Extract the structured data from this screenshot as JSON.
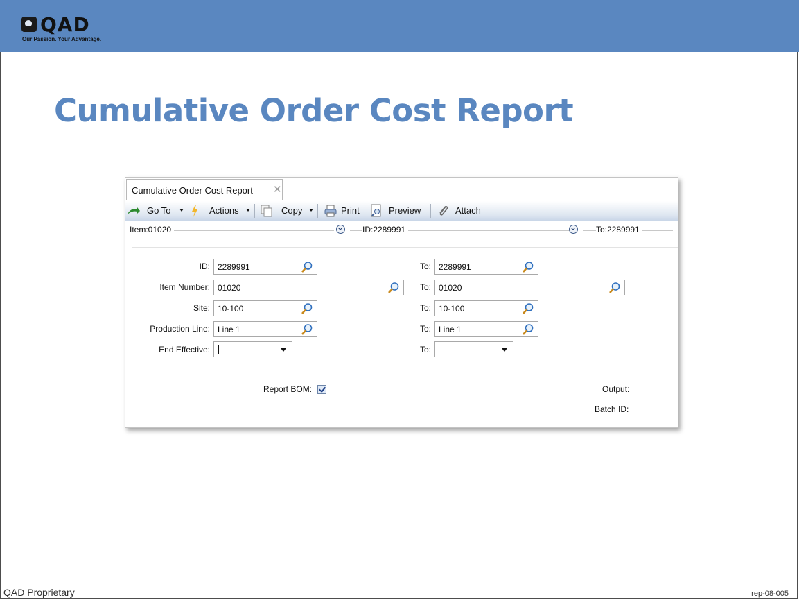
{
  "branding": {
    "logo_text": "QAD",
    "tagline": "Our Passion. Your Advantage."
  },
  "slide": {
    "title": "Cumulative Order Cost Report",
    "footer_left": "QAD Proprietary",
    "footer_right": "rep-08-005",
    "accent_color": "#5a87c0"
  },
  "tab": {
    "label": "Cumulative Order Cost Report",
    "close_icon": "close-icon"
  },
  "toolbar": {
    "goto_label": "Go To",
    "actions_label": "Actions",
    "copy_label": "Copy",
    "print_label": "Print",
    "preview_label": "Preview",
    "attach_label": "Attach"
  },
  "summary": {
    "item": "Item:01020",
    "id": "ID:2289991",
    "to": "To:2289991"
  },
  "form": {
    "id_label": "ID:",
    "id_value": "2289991",
    "id_to_label": "To:",
    "id_to_value": "2289991",
    "item_label": "Item Number:",
    "item_value": "01020",
    "item_to_label": "To:",
    "item_to_value": "01020",
    "site_label": "Site:",
    "site_value": "10-100",
    "site_to_label": "To:",
    "site_to_value": "10-100",
    "line_label": "Production Line:",
    "line_value": "Line 1",
    "line_to_label": "To:",
    "line_to_value": "Line 1",
    "eff_label": "End Effective:",
    "eff_value": "",
    "eff_to_label": "To:",
    "eff_to_value": "",
    "bom_label": "Report BOM:",
    "bom_checked": true,
    "output_label": "Output:",
    "batch_label": "Batch ID:"
  }
}
